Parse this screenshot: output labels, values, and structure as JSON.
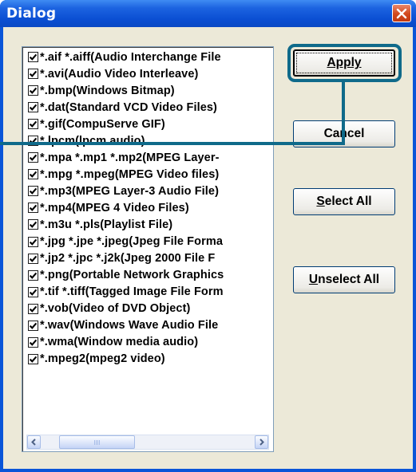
{
  "window": {
    "title": "Dialog",
    "close_icon": "close-x-icon",
    "accent": "#0a55d8"
  },
  "list": {
    "items": [
      {
        "label": "*.aif *.aiff(Audio Interchange File",
        "checked": true
      },
      {
        "label": "*.avi(Audio Video Interleave)",
        "checked": true
      },
      {
        "label": "*.bmp(Windows Bitmap)",
        "checked": true
      },
      {
        "label": "*.dat(Standard VCD Video Files)",
        "checked": true
      },
      {
        "label": "*.gif(CompuServe GIF)",
        "checked": true
      },
      {
        "label": "*.lpcm(lpcm audio)",
        "checked": true
      },
      {
        "label": "*.mpa *.mp1 *.mp2(MPEG Layer-",
        "checked": true
      },
      {
        "label": "*.mpg *.mpeg(MPEG Video files)",
        "checked": true
      },
      {
        "label": "*.mp3(MPEG Layer-3 Audio File)",
        "checked": true
      },
      {
        "label": "*.mp4(MPEG 4 Video Files)",
        "checked": true
      },
      {
        "label": "*.m3u *.pls(Playlist File)",
        "checked": true
      },
      {
        "label": "*.jpg *.jpe *.jpeg(Jpeg File Forma",
        "checked": true
      },
      {
        "label": "*.jp2 *.jpc *.j2k(Jpeg 2000 File F",
        "checked": true
      },
      {
        "label": "*.png(Portable Network Graphics",
        "checked": true
      },
      {
        "label": "*.tif *.tiff(Tagged Image File Form",
        "checked": true
      },
      {
        "label": "*.vob(Video of DVD Object)",
        "checked": true
      },
      {
        "label": "*.wav(Windows Wave Audio File",
        "checked": true
      },
      {
        "label": "*.wma(Window media audio)",
        "checked": true
      },
      {
        "label": "*.mpeg2(mpeg2 video)",
        "checked": true
      }
    ]
  },
  "buttons": {
    "apply": "Apply",
    "cancel": "Cancel",
    "select_all": "Select All",
    "unselect_all": "Unselect All"
  },
  "annotation": {
    "highlight_color": "#0f6a8a",
    "target": "Apply"
  }
}
